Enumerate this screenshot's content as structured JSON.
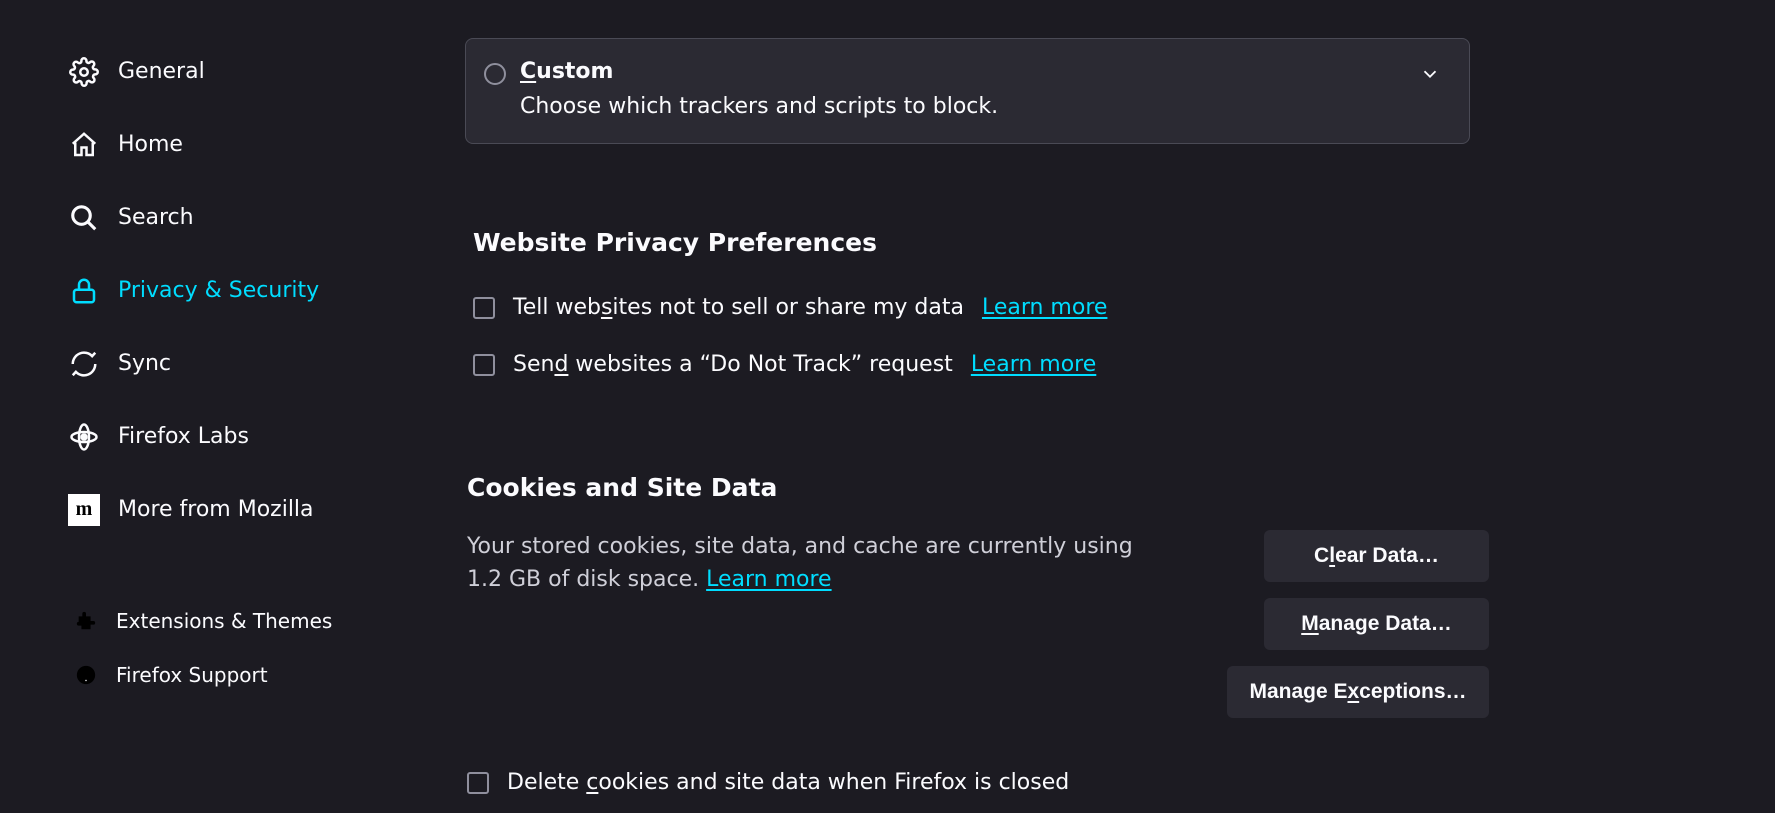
{
  "sidebar": {
    "items": [
      {
        "label": "General"
      },
      {
        "label": "Home"
      },
      {
        "label": "Search"
      },
      {
        "label": "Privacy & Security"
      },
      {
        "label": "Sync"
      },
      {
        "label": "Firefox Labs"
      },
      {
        "label": "More from Mozilla"
      }
    ],
    "secondary": [
      {
        "label": "Extensions & Themes"
      },
      {
        "label": "Firefox Support"
      }
    ]
  },
  "custom": {
    "title_pre": "C",
    "title_post": "ustom",
    "desc": "Choose which trackers and scripts to block."
  },
  "wpp": {
    "heading": "Website Privacy Preferences",
    "opt1_pre": "Tell web",
    "opt1_ul": "s",
    "opt1_post": "ites not to sell or share my data",
    "learn_more": "Learn more",
    "opt2_pre": "Sen",
    "opt2_ul": "d",
    "opt2_post": " websites a “Do Not Track” request"
  },
  "cookies": {
    "heading": "Cookies and Site Data",
    "desc_pre": "Your stored cookies, site data, and cache are currently using 1.2 GB of disk space. ",
    "learn_more": "Learn more",
    "clear_pre": "C",
    "clear_ul": "l",
    "clear_post": "ear Data…",
    "manage_pre": "",
    "manage_ul": "M",
    "manage_post": "anage Data…",
    "except_pre": "Manage E",
    "except_ul": "x",
    "except_post": "ceptions…",
    "delete_pre": "Delete ",
    "delete_ul": "c",
    "delete_post": "ookies and site data when Firefox is closed"
  }
}
